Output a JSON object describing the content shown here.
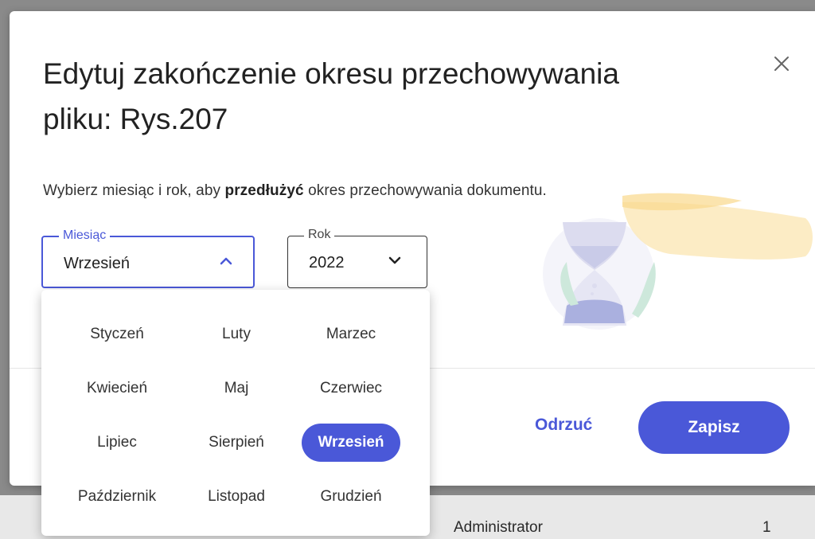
{
  "dialog": {
    "title": "Edytuj zakończenie okresu przechowywania pliku: Rys.207",
    "description_before": "Wybierz miesiąc i rok, aby ",
    "description_bold": "przedłużyć",
    "description_after": " okres przechowywania dokumentu.",
    "close_icon": "close-icon"
  },
  "month_field": {
    "label": "Miesiąc",
    "value": "Wrzesień",
    "icon": "chevron-up-icon"
  },
  "year_field": {
    "label": "Rok",
    "value": "2022",
    "icon": "chevron-down-icon"
  },
  "months": [
    "Styczeń",
    "Luty",
    "Marzec",
    "Kwiecień",
    "Maj",
    "Czerwiec",
    "Lipiec",
    "Sierpień",
    "Wrzesień",
    "Październik",
    "Listopad",
    "Grudzień"
  ],
  "selected_month_index": 8,
  "footer": {
    "discard_label": "Odrzuć",
    "save_label": "Zapisz"
  },
  "background_row": {
    "owner": "Administrator",
    "count": "1"
  },
  "colors": {
    "accent": "#4a58d8"
  }
}
